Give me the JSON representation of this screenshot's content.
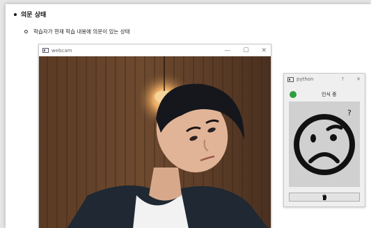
{
  "doc": {
    "heading": "의문 상태",
    "subtext": "학습자가 현재 학습 내용에 의문이 있는 상태"
  },
  "webcam_window": {
    "title": "webcam",
    "controls": {
      "minimize": "—",
      "maximize": "☐",
      "close": "✕"
    }
  },
  "python_window": {
    "title": "python",
    "controls": {
      "help": "?",
      "close": "✕"
    },
    "status_text": "인식 중",
    "status_color": "#2e9e3e",
    "question_mark": "?",
    "button_icon": "hand-icon"
  }
}
